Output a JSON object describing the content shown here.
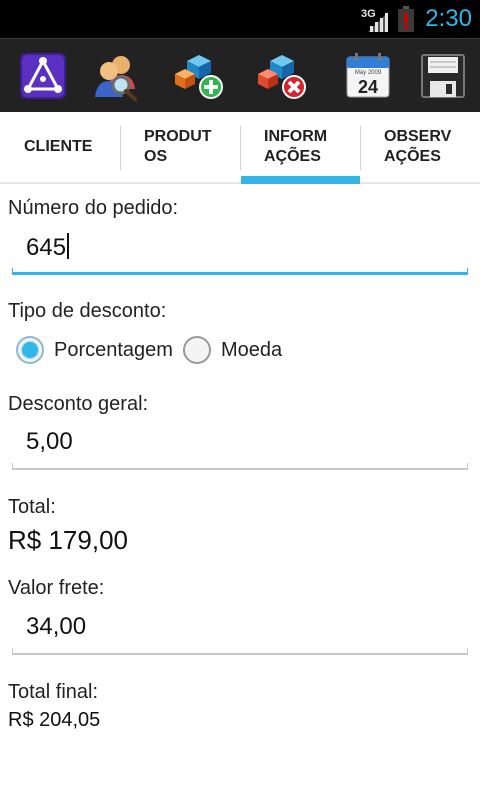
{
  "status_bar": {
    "network": "3G",
    "time": "2:30",
    "accent_color": "#33b5e5",
    "battery_color": "#cc0000"
  },
  "toolbar": {
    "buttons": [
      {
        "name": "app-logo-icon"
      },
      {
        "name": "client-search-icon"
      },
      {
        "name": "add-item-icon"
      },
      {
        "name": "remove-item-icon"
      },
      {
        "name": "calendar-icon",
        "text": "May 2009",
        "day": "24"
      },
      {
        "name": "save-icon"
      }
    ]
  },
  "tabs": [
    {
      "label": "CLIENTE"
    },
    {
      "label": "PRODUT\nOS"
    },
    {
      "label": "INFORM\nAÇÕES",
      "active": true
    },
    {
      "label": "OBSERV\nAÇÕES"
    }
  ],
  "form": {
    "order_number_label": "Número do pedido:",
    "order_number_value": "645",
    "discount_type_label": "Tipo de desconto:",
    "discount_options": [
      {
        "label": "Porcentagem",
        "checked": true
      },
      {
        "label": "Moeda",
        "checked": false
      }
    ],
    "general_discount_label": "Desconto geral:",
    "general_discount_value": "5,00",
    "total_label": "Total:",
    "total_value": "R$ 179,00",
    "freight_label": "Valor frete:",
    "freight_value": "34,00",
    "final_total_label": "Total final:",
    "final_total_value": "R$ 204,05"
  }
}
